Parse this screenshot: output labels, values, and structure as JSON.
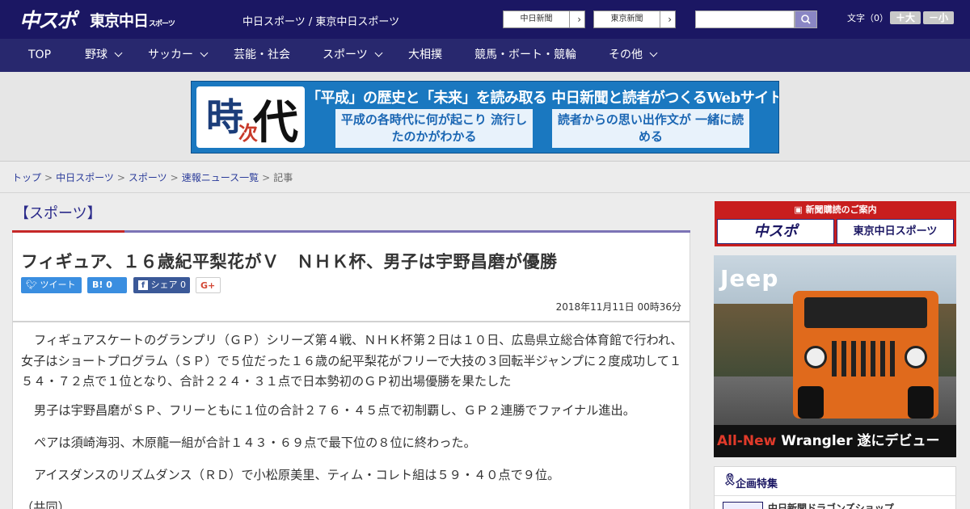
{
  "header": {
    "logo_main": "中スポ",
    "logo_tokyo": "東京中日",
    "logo_tokyo_small": "スポーツ",
    "site_links": "中日スポーツ / 東京中日スポーツ",
    "paper_buttons": [
      "中日新聞",
      "東京新聞"
    ],
    "search_placeholder": "",
    "font_size_label": "文字（0）",
    "font_larger": "＋大",
    "font_smaller": "－小"
  },
  "nav": {
    "items": [
      "TOP",
      "野球",
      "サッカー",
      "芸能・社会",
      "スポーツ",
      "大相撲",
      "競馬・ボート・競輪",
      "その他"
    ]
  },
  "banner": {
    "kanji": [
      "時",
      "次",
      "代"
    ],
    "headline": "「平成」の歴史と「未来」を読み取る 中日新聞と読者がつくるWebサイト",
    "box_left": "平成の各時代に何が起こり 流行したのかがわかる",
    "box_right": "読者からの思い出作文が 一緒に読める"
  },
  "breadcrumb": {
    "items": [
      "トップ",
      "中日スポーツ",
      "スポーツ",
      "速報ニュース一覧"
    ],
    "current": "記事"
  },
  "section": {
    "title": "【スポーツ】"
  },
  "article": {
    "title": "フィギュア、１６歳紀平梨花がＶ　ＮＨＫ杯、男子は宇野昌磨が優勝",
    "share": {
      "twitter": "ツイート",
      "hatena": "B! 0",
      "facebook": "シェア 0",
      "gplus": "G+"
    },
    "date": "2018年11月11日 00時36分",
    "paragraphs": [
      "フィギュアスケートのグランプリ（ＧＰ）シリーズ第４戦、ＮＨＫ杯第２日は１０日、広島県立総合体育館で行われ、女子はショートプログラム（ＳＰ）で５位だった１６歳の紀平梨花がフリーで大技の３回転半ジャンプに２度成功して１５４・７２点で１位となり、合計２２４・３１点で日本勢初のＧＰ初出場優勝を果たした",
      "男子は宇野昌磨がＳＰ、フリーともに１位の合計２７６・４５点で初制覇し、ＧＰ２連勝でファイナル進出。",
      "ペアは須崎海羽、木原龍一組が合計１４３・６９点で最下位の８位に終わった。",
      "アイスダンスのリズムダンス（ＲＤ）で小松原美里、ティム・コレト組は５９・４０点で９位。",
      "（共同）"
    ]
  },
  "sidebar": {
    "subscription_title": "新聞購読のご案内",
    "subscription_papers": [
      "中スポ",
      "東京中日スポーツ"
    ],
    "ad": {
      "brand": "Jeep",
      "tagline_red": "All-New",
      "tagline": " Wrangler 遂にデビュー"
    },
    "feature_title": "企画特集",
    "feature_item": "中日新聞ドラゴンズショップ"
  }
}
